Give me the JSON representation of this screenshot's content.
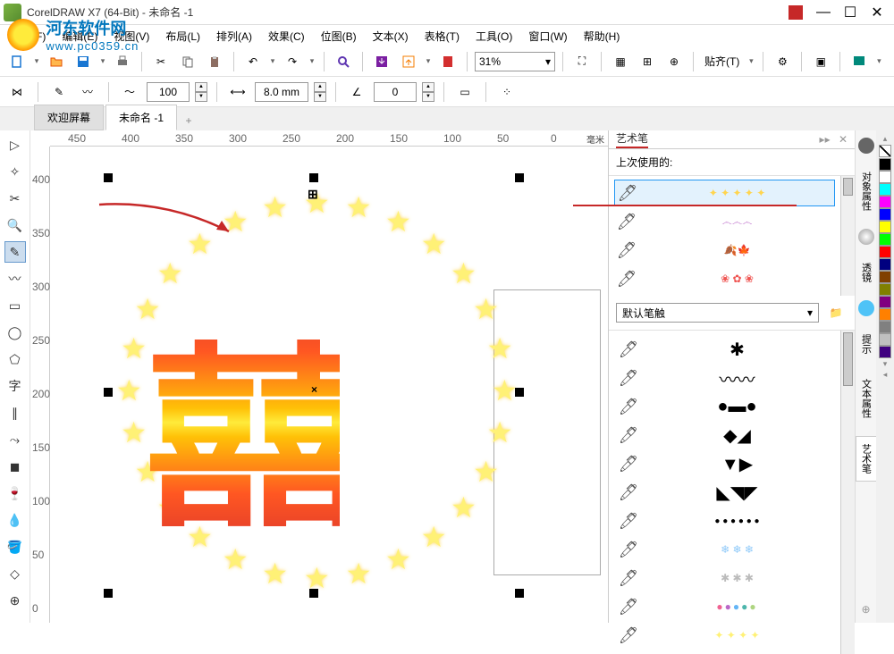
{
  "title": "CorelDRAW X7 (64-Bit) - 未命名 -1",
  "watermark": {
    "cn": "河东软件网",
    "url": "www.pc0359.cn"
  },
  "menu": {
    "file": "文件(F)",
    "edit": "编辑(E)",
    "view": "视图(V)",
    "layout": "布局(L)",
    "arrange": "排列(A)",
    "effects": "效果(C)",
    "bitmap": "位图(B)",
    "text": "文本(X)",
    "table": "表格(T)",
    "tools": "工具(O)",
    "window": "窗口(W)",
    "help": "帮助(H)"
  },
  "toolbar": {
    "zoom": "31%",
    "paste": "贴齐(T)"
  },
  "propbar": {
    "val1": "100",
    "val2": "8.0 mm",
    "val3": "0"
  },
  "tabs": {
    "welcome": "欢迎屏幕",
    "doc": "未命名 -1",
    "add": "+"
  },
  "ruler": {
    "unit": "毫米",
    "h": [
      "450",
      "400",
      "350",
      "300",
      "250",
      "200",
      "150",
      "100",
      "50",
      "0"
    ],
    "v": [
      "400",
      "350",
      "300",
      "250",
      "200",
      "150",
      "100",
      "50",
      "0"
    ]
  },
  "canvas": {
    "xi": "囍",
    "center": "×"
  },
  "docker": {
    "title": "艺术笔",
    "last_used": "上次使用的:",
    "default_combo": "默认笔触",
    "dd": "▾"
  },
  "colors": [
    "#000000",
    "#ffffff",
    "#00ffff",
    "#ff00ff",
    "#0000ff",
    "#ffff00",
    "#00ff00",
    "#ff0000",
    "#000080",
    "#804000",
    "#808000",
    "#800080",
    "#ff8000",
    "#808080",
    "#c0c0c0",
    "#400080"
  ],
  "docker_tabs": {
    "obj": "对象属性",
    "lens": "透镜",
    "hint": "提示",
    "text": "文本属性",
    "art": "艺术笔"
  }
}
